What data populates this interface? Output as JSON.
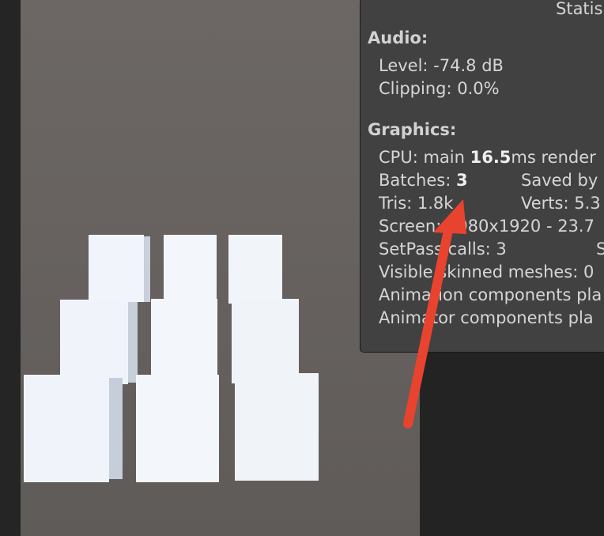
{
  "stats": {
    "title": "Statis",
    "audio": {
      "heading": "Audio:",
      "level": "Level: -74.8 dB",
      "clipping": "Clipping: 0.0%"
    },
    "graphics": {
      "heading": "Graphics:",
      "cpu_prefix": "CPU: main ",
      "cpu_value": "16.5",
      "cpu_suffix": "ms  render",
      "batches_prefix": "Batches: ",
      "batches_value": "3",
      "saved": "Saved by",
      "tris": "Tris: 1.8k",
      "verts": "Verts: 5.3",
      "screen": "Screen: 1080x1920 - 23.7",
      "setpass": "SetPass calls: 3",
      "setpass_trail": "S",
      "skinned": "Visible skinned meshes: 0",
      "animation": "Animation components pla",
      "animator": "Animator components pla"
    }
  },
  "annotation": {
    "arrow_color": "#e8432f"
  },
  "scene": {
    "cube_count": 9,
    "cube_color": "#f2f6fb"
  }
}
